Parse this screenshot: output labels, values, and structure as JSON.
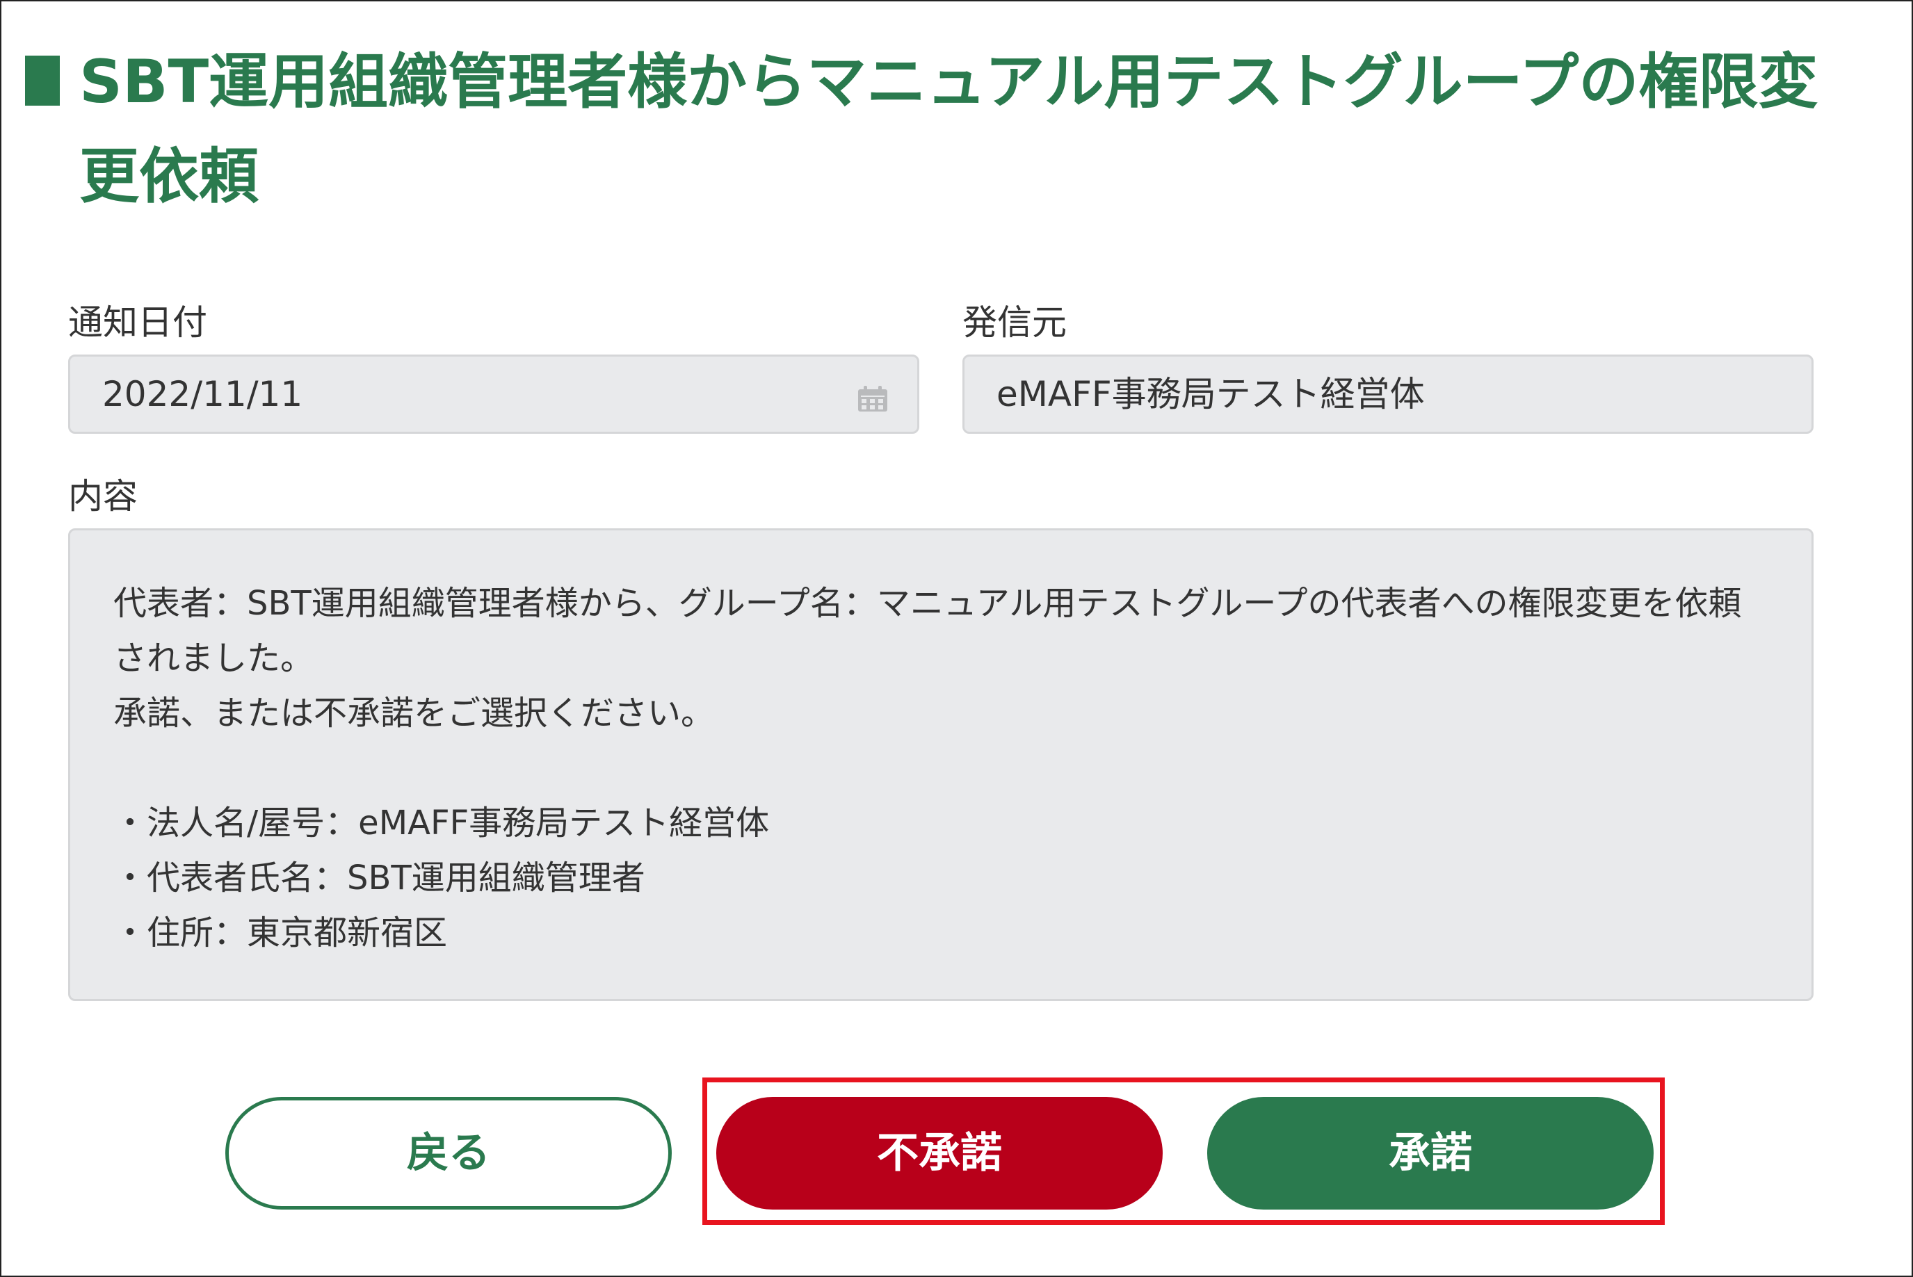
{
  "page": {
    "title": "SBT運用組織管理者様からマニュアル用テストグループの権限変更依頼"
  },
  "fields": {
    "notify_date": {
      "label": "通知日付",
      "value": "2022/11/11"
    },
    "sender": {
      "label": "発信元",
      "value": "eMAFF事務局テスト経営体"
    }
  },
  "content": {
    "label": "内容",
    "lines": [
      "代表者：SBT運用組織管理者様から、グループ名：マニュアル用テストグループの代表者への権限変更を依頼されました。",
      "承諾、または不承諾をご選択ください。",
      "",
      "・法人名/屋号：eMAFF事務局テスト経営体",
      "・代表者氏名：SBT運用組織管理者",
      "・住所：東京都新宿区"
    ]
  },
  "buttons": {
    "back": "戻る",
    "reject": "不承諾",
    "approve": "承諾"
  },
  "colors": {
    "accent": "#2a7a4e",
    "reject": "#b8001a",
    "highlight": "#e8141f",
    "field_bg": "#e9eaec"
  },
  "icons": {
    "date_field": "calendar-icon"
  }
}
